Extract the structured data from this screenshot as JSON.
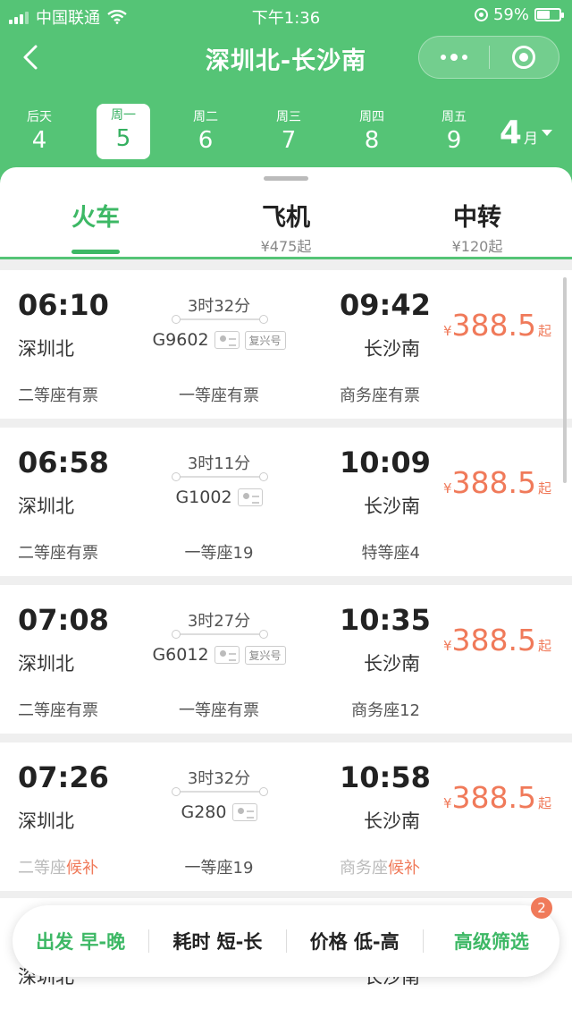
{
  "status": {
    "carrier": "中国联通",
    "time": "下午1:36",
    "battery": "59%",
    "battery_level": 0.59
  },
  "nav": {
    "title": "深圳北-长沙南"
  },
  "dates": [
    {
      "weekday": "后天",
      "day": "4",
      "active": false
    },
    {
      "weekday": "周一",
      "day": "5",
      "active": true
    },
    {
      "weekday": "周二",
      "day": "6",
      "active": false
    },
    {
      "weekday": "周三",
      "day": "7",
      "active": false
    },
    {
      "weekday": "周四",
      "day": "8",
      "active": false
    },
    {
      "weekday": "周五",
      "day": "9",
      "active": false
    }
  ],
  "month": {
    "number": "4",
    "unit": "月"
  },
  "tabs": [
    {
      "label": "火车",
      "sub": "",
      "active": true
    },
    {
      "label": "飞机",
      "sub": "¥475起",
      "active": false
    },
    {
      "label": "中转",
      "sub": "¥120起",
      "active": false
    }
  ],
  "trains": [
    {
      "depart_time": "06:10",
      "depart_station": "深圳北",
      "duration": "3时32分",
      "train_no": "G9602",
      "fuxing": "复兴号",
      "arrive_time": "09:42",
      "arrive_station": "长沙南",
      "price_currency": "¥",
      "price": "388.5",
      "price_suffix": "起",
      "seats": [
        {
          "name": "二等座有票",
          "status": ""
        },
        {
          "name": "一等座有票",
          "status": ""
        },
        {
          "name": "商务座有票",
          "status": ""
        }
      ]
    },
    {
      "depart_time": "06:58",
      "depart_station": "深圳北",
      "duration": "3时11分",
      "train_no": "G1002",
      "fuxing": "",
      "arrive_time": "10:09",
      "arrive_station": "长沙南",
      "price_currency": "¥",
      "price": "388.5",
      "price_suffix": "起",
      "seats": [
        {
          "name": "二等座有票",
          "status": ""
        },
        {
          "name": "一等座19",
          "status": ""
        },
        {
          "name": "特等座4",
          "status": ""
        }
      ]
    },
    {
      "depart_time": "07:08",
      "depart_station": "深圳北",
      "duration": "3时27分",
      "train_no": "G6012",
      "fuxing": "复兴号",
      "arrive_time": "10:35",
      "arrive_station": "长沙南",
      "price_currency": "¥",
      "price": "388.5",
      "price_suffix": "起",
      "seats": [
        {
          "name": "二等座有票",
          "status": ""
        },
        {
          "name": "一等座有票",
          "status": ""
        },
        {
          "name": "商务座12",
          "status": ""
        }
      ]
    },
    {
      "depart_time": "07:26",
      "depart_station": "深圳北",
      "duration": "3时32分",
      "train_no": "G280",
      "fuxing": "",
      "arrive_time": "10:58",
      "arrive_station": "长沙南",
      "price_currency": "¥",
      "price": "388.5",
      "price_suffix": "起",
      "seats": [
        {
          "name": "二等座",
          "status": "候补"
        },
        {
          "name": "一等座19",
          "status": ""
        },
        {
          "name": "商务座",
          "status": "候补"
        }
      ]
    }
  ],
  "peek": {
    "depart_station": "深圳北",
    "arrive_station": "长沙南"
  },
  "filters": [
    {
      "label": "出发 早-晚",
      "green": true
    },
    {
      "label": "耗时 短-长",
      "green": false
    },
    {
      "label": "价格 低-高",
      "green": false
    },
    {
      "label": "高级筛选",
      "green": true,
      "badge": "2"
    }
  ],
  "colors": {
    "brand_green": "#55c476",
    "active_green": "#3db865",
    "price_orange": "#f07a5a"
  }
}
